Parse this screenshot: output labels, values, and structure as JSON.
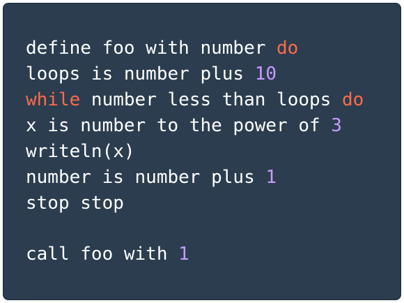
{
  "code": {
    "line1": {
      "a": "define foo with number ",
      "kw": "do"
    },
    "line2": {
      "a": "loops is number plus ",
      "num": "10"
    },
    "line3": {
      "kw1": "while",
      "a": " number less than loops ",
      "kw2": "do"
    },
    "line4": {
      "a": "x is number to the power of ",
      "num": "3"
    },
    "line5": {
      "a": "writeln(x)"
    },
    "line6": {
      "a": "number is number plus ",
      "num": "1"
    },
    "line7": {
      "a": "stop stop"
    },
    "line8": {
      "a": "call foo with ",
      "num": "1"
    }
  },
  "colors": {
    "background": "#2b3d4f",
    "text": "#ffffff",
    "keyword": "#ff6b4a",
    "number": "#c79bff"
  }
}
